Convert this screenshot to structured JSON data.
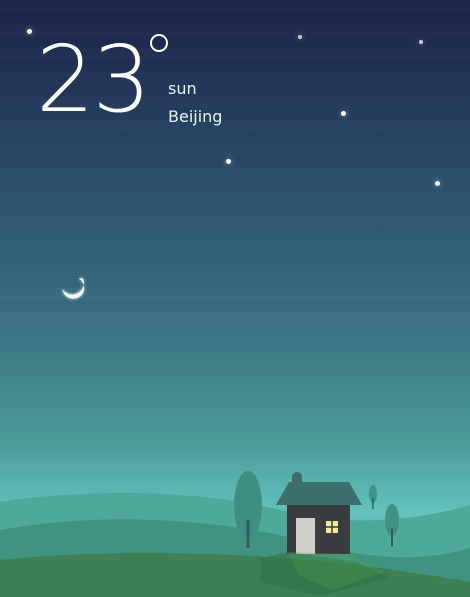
{
  "weather": {
    "temperature": "23",
    "condition": "sun",
    "city": "Beijing"
  },
  "icons": {
    "degree": "degree-icon",
    "moon": "crescent-moon-icon",
    "star": "star-icon",
    "house": "house-icon",
    "tree": "tree-icon"
  },
  "colors": {
    "sky_top": "#1b2147",
    "sky_bottom": "#61c2bd",
    "hills": "#4fa08f",
    "foreground": "#4f8d5a",
    "house_roof": "#3f6f6d",
    "house_wall": "#3a3c40",
    "door": "#d0d0c8",
    "window_light": "#f3e89a",
    "moon": "#ffffff"
  }
}
